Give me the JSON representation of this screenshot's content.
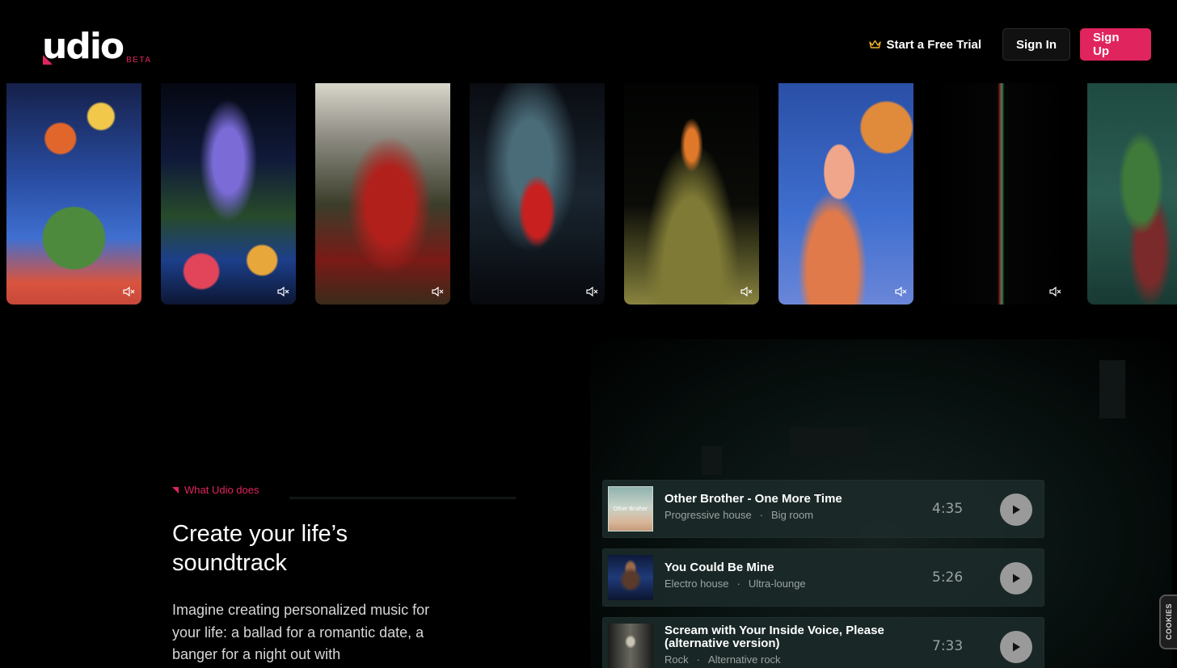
{
  "brand": {
    "logo_text": "udio",
    "badge": "BETA",
    "accent": "#e0245e"
  },
  "nav": {
    "trial_label": "Start a Free Trial",
    "sign_in": "Sign In",
    "sign_up": "Sign Up"
  },
  "hero": {
    "eyebrow": "What Udio does",
    "headline": "Create your life’s soundtrack",
    "description": "Imagine creating personalized music for your life: a ballad for a romantic date, a banger for a night out with"
  },
  "tracks": [
    {
      "title": "Other Brother - One More Time",
      "tags": [
        "Progressive house",
        "Big room"
      ],
      "duration": "4:35",
      "cover_text": "Other Brother"
    },
    {
      "title": "You Could Be Mine",
      "tags": [
        "Electro house",
        "Ultra-lounge"
      ],
      "duration": "5:26"
    },
    {
      "title": "Scream with Your Inside Voice, Please (alternative version)",
      "tags": [
        "Rock",
        "Alternative rock"
      ],
      "duration": "7:33"
    }
  ],
  "cookie_tab": "COOKIES"
}
